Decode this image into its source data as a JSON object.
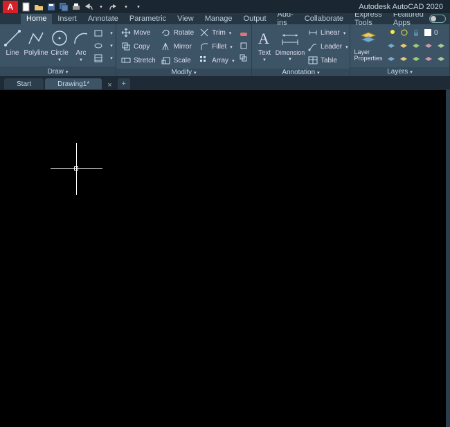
{
  "app": {
    "title": "Autodesk AutoCAD 2020",
    "badge": "A"
  },
  "qat": [
    "new",
    "open",
    "save",
    "saveall",
    "print",
    "undo",
    "redo"
  ],
  "menu": {
    "tabs": [
      "Home",
      "Insert",
      "Annotate",
      "Parametric",
      "View",
      "Manage",
      "Output",
      "Add-ins",
      "Collaborate",
      "Express Tools",
      "Featured Apps"
    ],
    "active": 0
  },
  "ribbon": {
    "draw": {
      "label": "Draw",
      "line": "Line",
      "polyline": "Polyline",
      "circle": "Circle",
      "arc": "Arc"
    },
    "modify": {
      "label": "Modify",
      "move": "Move",
      "copy": "Copy",
      "stretch": "Stretch",
      "rotate": "Rotate",
      "mirror": "Mirror",
      "scale": "Scale",
      "trim": "Trim",
      "fillet": "Fillet",
      "array": "Array"
    },
    "annotation": {
      "label": "Annotation",
      "text": "Text",
      "dimension": "Dimension",
      "linear": "Linear",
      "leader": "Leader",
      "table": "Table"
    },
    "layers": {
      "label": "Layers",
      "props": "Layer\nProperties",
      "current": "0"
    }
  },
  "doctabs": {
    "start": "Start",
    "drawing": "Drawing1*"
  }
}
